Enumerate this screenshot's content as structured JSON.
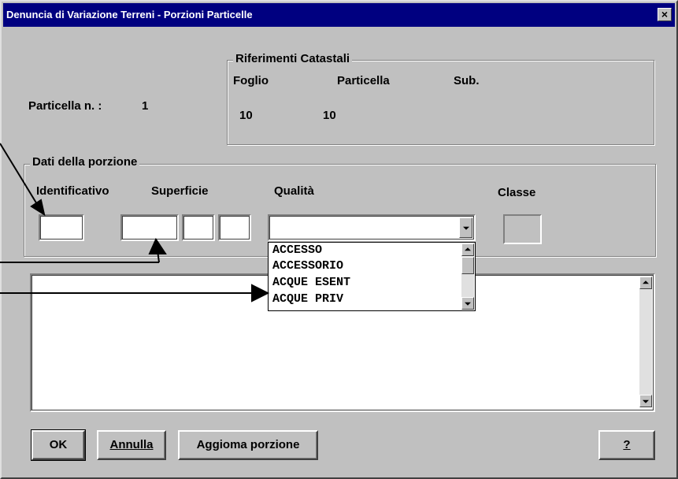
{
  "window": {
    "title": "Denuncia di Variazione Terreni - Porzioni Particelle",
    "close_label": "×"
  },
  "particella": {
    "label": "Particella n. :",
    "value": "1"
  },
  "riferimenti": {
    "legend": "Riferimenti Catastali",
    "foglio_label": "Foglio",
    "particella_label": "Particella",
    "sub_label": "Sub.",
    "foglio_value": "10",
    "particella_value": "10",
    "sub_value": ""
  },
  "porzione": {
    "legend": "Dati della porzione",
    "identificativo_label": "Identificativo",
    "superficie_label": "Superficie",
    "qualita_label": "Qualità",
    "classe_label": "Classe",
    "identificativo_value": "",
    "superficie_values": [
      "",
      "",
      ""
    ],
    "qualita_value": "",
    "classe_value": ""
  },
  "qualita_options": [
    "ACCESSO",
    "ACCESSORIO",
    "ACQUE ESENT",
    "ACQUE PRIV"
  ],
  "buttons": {
    "ok": "OK",
    "annulla": "Annulla",
    "aggiorna": "Aggioma porzione",
    "help": "?"
  }
}
